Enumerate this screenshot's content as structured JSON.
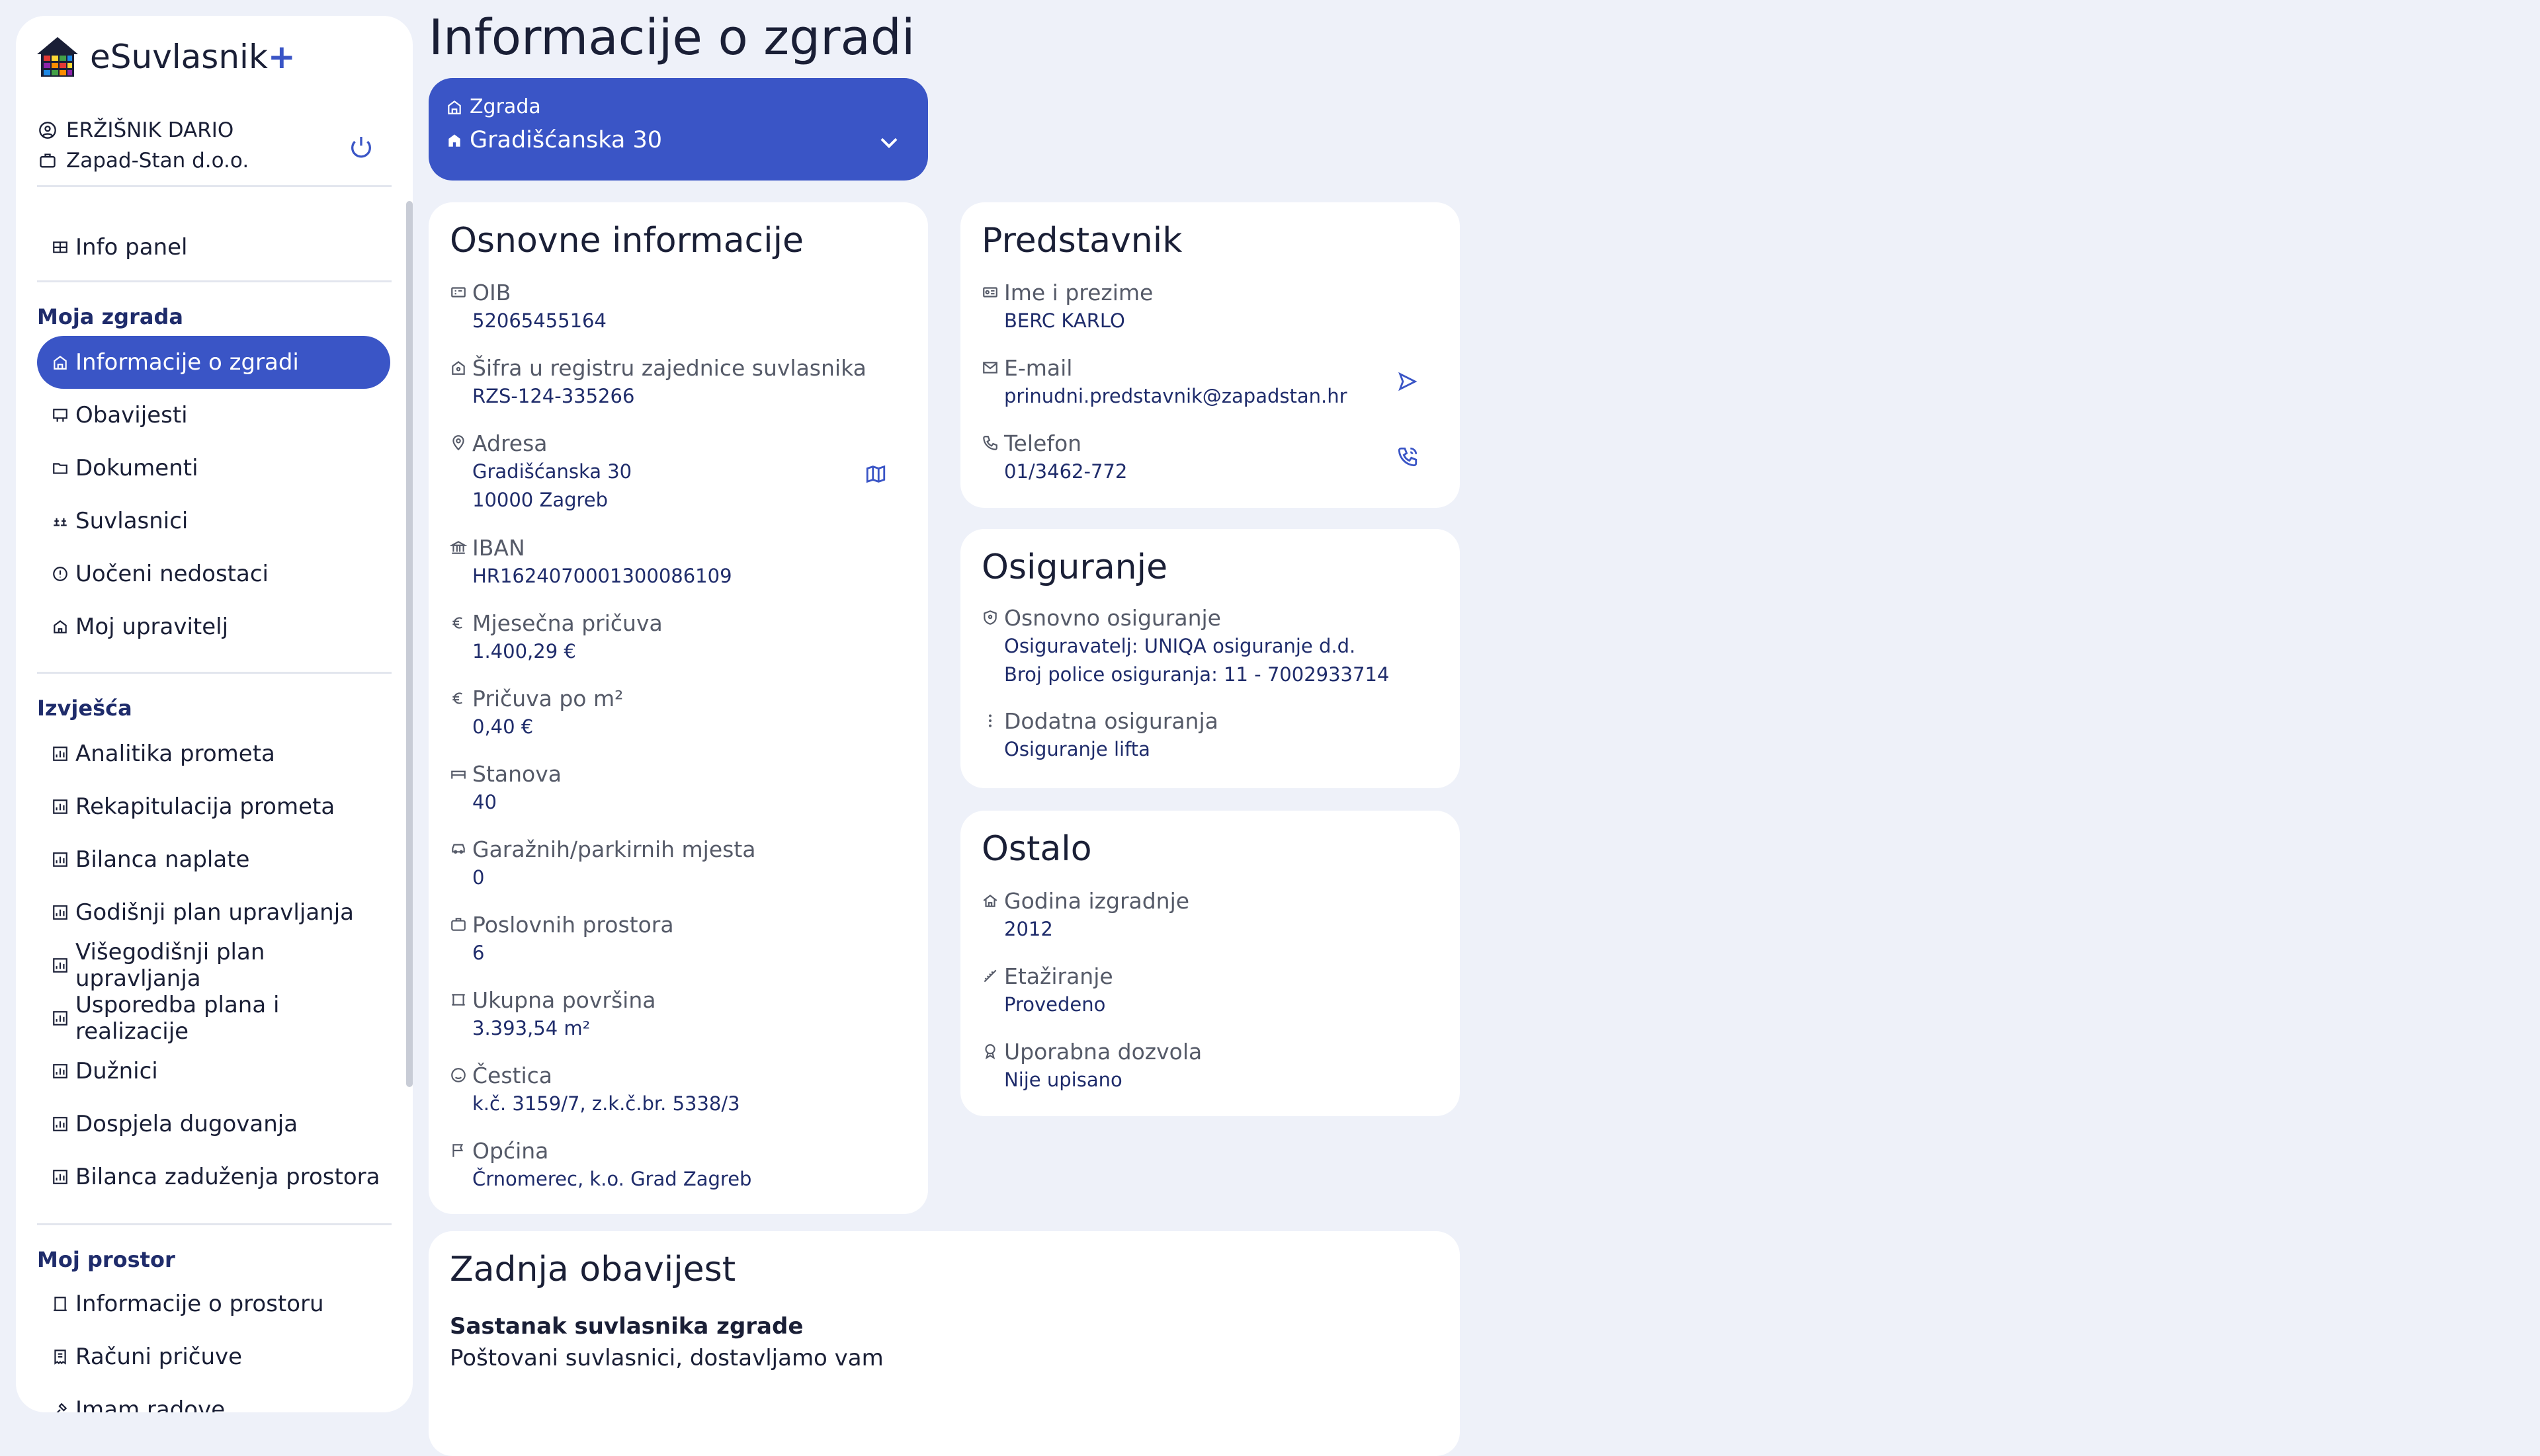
{
  "app": {
    "name": "eSuvlasnik",
    "plus": "+"
  },
  "user": {
    "name": "ERŽIŠNIK DARIO",
    "company": "Zapad-Stan d.o.o."
  },
  "nav": {
    "info_panel": "Info panel",
    "moja_zgrada": {
      "title": "Moja zgrada",
      "items": [
        "Informacije o zgradi",
        "Obavijesti",
        "Dokumenti",
        "Suvlasnici",
        "Uočeni nedostaci",
        "Moj upravitelj"
      ]
    },
    "izvjesca": {
      "title": "Izvješća",
      "items": [
        "Analitika prometa",
        "Rekapitulacija prometa",
        "Bilanca naplate",
        "Godišnji plan upravljanja",
        "Višegodišnji plan upravljanja",
        "Usporedba plana i realizacije",
        "Dužnici",
        "Dospjela dugovanja",
        "Bilanca zaduženja prostora"
      ]
    },
    "moj_prostor": {
      "title": "Moj prostor",
      "items": [
        "Informacije o prostoru",
        "Računi pričuve",
        "Imam radove"
      ]
    }
  },
  "page": {
    "title": "Informacije o zgradi",
    "building_select": {
      "label": "Zgrada",
      "value": "Gradišćanska 30"
    }
  },
  "osnovne": {
    "title": "Osnovne informacije",
    "oib_label": "OIB",
    "oib": "52065455164",
    "sifra_label": "Šifra u registru zajednice suvlasnika",
    "sifra": "RZS-124-335266",
    "adresa_label": "Adresa",
    "adresa_1": "Gradišćanska 30",
    "adresa_2": "10000 Zagreb",
    "iban_label": "IBAN",
    "iban": "HR1624070001300086109",
    "pricuva_label": "Mjesečna pričuva",
    "pricuva": "1.400,29 €",
    "pricuva_m2_label": "Pričuva po m²",
    "pricuva_m2": "0,40 €",
    "stanova_label": "Stanova",
    "stanova": "40",
    "garaza_label": "Garažnih/parkirnih mjesta",
    "garaza": "0",
    "poslovnih_label": "Poslovnih prostora",
    "poslovnih": "6",
    "povrsina_label": "Ukupna površina",
    "povrsina": "3.393,54 m²",
    "cestica_label": "Čestica",
    "cestica": "k.č. 3159/7, z.k.č.br. 5338/3",
    "opcina_label": "Općina",
    "opcina": "Črnomerec, k.o. Grad Zagreb"
  },
  "predstavnik": {
    "title": "Predstavnik",
    "ime_label": "Ime i prezime",
    "ime": "BERC KARLO",
    "email_label": "E-mail",
    "email": "prinudni.predstavnik@zapadstan.hr",
    "telefon_label": "Telefon",
    "telefon": "01/3462-772"
  },
  "osiguranje": {
    "title": "Osiguranje",
    "osnovno_label": "Osnovno osiguranje",
    "osnovno_1": "Osiguravatelj: UNIQA osiguranje d.d.",
    "osnovno_2": "Broj police osiguranja: 11 - 7002933714",
    "dodatna_label": "Dodatna osiguranja",
    "dodatna": "Osiguranje lifta"
  },
  "ostalo": {
    "title": "Ostalo",
    "godina_label": "Godina izgradnje",
    "godina": "2012",
    "etaz_label": "Etažiranje",
    "etaz": "Provedeno",
    "dozvola_label": "Uporabna dozvola",
    "dozvola": "Nije upisano"
  },
  "obavijest": {
    "title": "Zadnja obavijest",
    "heading": "Sastanak suvlasnika zgrade",
    "text": "Poštovani suvlasnici, dostavljamo vam"
  },
  "colors": {
    "accent": "#3a55c6",
    "background": "#eef1f9",
    "value_text": "#1f2c6b"
  }
}
